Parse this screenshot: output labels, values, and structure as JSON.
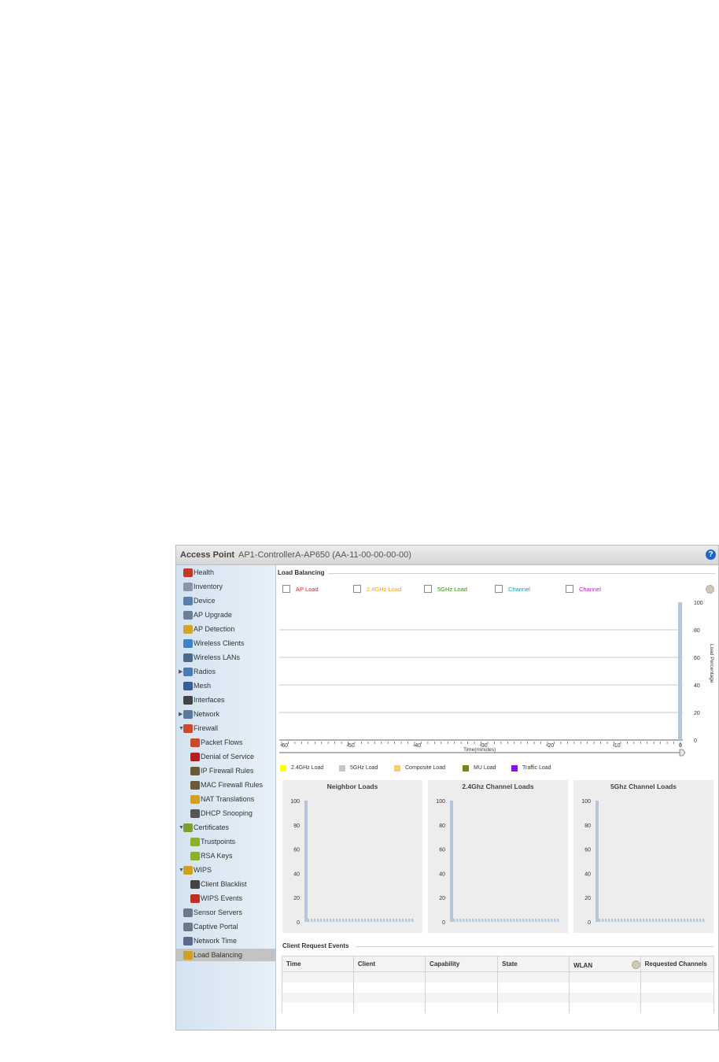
{
  "titlebar": {
    "section": "Access Point",
    "device": "AP1-ControllerA-AP650 (AA-11-00-00-00-00)",
    "help_glyph": "?"
  },
  "sidebar": {
    "items": [
      {
        "label": "Health",
        "icon": "health-icon",
        "level": 0
      },
      {
        "label": "Inventory",
        "icon": "inventory-icon",
        "level": 0
      },
      {
        "label": "Device",
        "icon": "device-icon",
        "level": 0
      },
      {
        "label": "AP Upgrade",
        "icon": "ap-upgrade-icon",
        "level": 0
      },
      {
        "label": "AP Detection",
        "icon": "ap-detection-icon",
        "level": 0
      },
      {
        "label": "Wireless Clients",
        "icon": "wireless-clients-icon",
        "level": 0
      },
      {
        "label": "Wireless LANs",
        "icon": "wireless-lans-icon",
        "level": 0
      },
      {
        "label": "Radios",
        "icon": "radios-icon",
        "level": 0,
        "expander": "collapsed"
      },
      {
        "label": "Mesh",
        "icon": "mesh-icon",
        "level": 0
      },
      {
        "label": "Interfaces",
        "icon": "interfaces-icon",
        "level": 0
      },
      {
        "label": "Network",
        "icon": "network-icon",
        "level": 0,
        "expander": "collapsed"
      },
      {
        "label": "Firewall",
        "icon": "firewall-icon",
        "level": 0,
        "expander": "expanded"
      },
      {
        "label": "Packet Flows",
        "icon": "packet-flows-icon",
        "level": 1
      },
      {
        "label": "Denial of Service",
        "icon": "denial-of-service-icon",
        "level": 1
      },
      {
        "label": "IP Firewall Rules",
        "icon": "ip-firewall-rules-icon",
        "level": 1
      },
      {
        "label": "MAC Firewall Rules",
        "icon": "mac-firewall-rules-icon",
        "level": 1
      },
      {
        "label": "NAT Translations",
        "icon": "nat-translations-icon",
        "level": 1
      },
      {
        "label": "DHCP Snooping",
        "icon": "dhcp-snooping-icon",
        "level": 1
      },
      {
        "label": "Certificates",
        "icon": "certificates-icon",
        "level": 0,
        "expander": "expanded"
      },
      {
        "label": "Trustpoints",
        "icon": "trustpoints-icon",
        "level": 1
      },
      {
        "label": "RSA Keys",
        "icon": "rsa-keys-icon",
        "level": 1
      },
      {
        "label": "WIPS",
        "icon": "wips-icon",
        "level": 0,
        "expander": "expanded"
      },
      {
        "label": "Client Blacklist",
        "icon": "client-blacklist-icon",
        "level": 1
      },
      {
        "label": "WIPS Events",
        "icon": "wips-events-icon",
        "level": 1
      },
      {
        "label": "Sensor Servers",
        "icon": "sensor-servers-icon",
        "level": 0
      },
      {
        "label": "Captive Portal",
        "icon": "captive-portal-icon",
        "level": 0
      },
      {
        "label": "Network Time",
        "icon": "network-time-icon",
        "level": 0
      },
      {
        "label": "Load Balancing",
        "icon": "load-balancing-icon",
        "level": 0,
        "selected": true
      }
    ]
  },
  "load_balancing": {
    "title": "Load Balancing",
    "toggles": [
      {
        "label": "AP Load",
        "color": "#e02020"
      },
      {
        "label": "2.4GHz Load",
        "color": "#f0a020"
      },
      {
        "label": "5GHz Load",
        "color": "#3a8a1a"
      },
      {
        "label": "Channel",
        "color": "#1a9ab0"
      },
      {
        "label": "Channel",
        "color": "#c020c0"
      }
    ],
    "settings_icon": "gear-icon",
    "chart_data": {
      "type": "bar",
      "ylabel": "Load Percentage",
      "xlabel": "Time(minutes)",
      "ylim": [
        0,
        100
      ],
      "yticks": [
        "100",
        "80",
        "60",
        "40",
        "20",
        "0"
      ],
      "xticks": [
        "-60",
        "-50",
        "-40",
        "-30",
        "-20",
        "-10",
        "0"
      ],
      "bars": [
        {
          "x": 0,
          "value": 100
        }
      ]
    },
    "legend": [
      {
        "label": "2.4GHz Load",
        "color": "#ffff00"
      },
      {
        "label": "5GHz Load",
        "color": "#c8c8c8"
      },
      {
        "label": "Composite Load",
        "color": "#f3cf70"
      },
      {
        "label": "MU Load",
        "color": "#808010"
      },
      {
        "label": "Traffic Load",
        "color": "#8a10f0"
      }
    ]
  },
  "panels": [
    {
      "title": "Neighbor Loads",
      "yticks": [
        "100",
        "80",
        "60",
        "40",
        "20",
        "0"
      ],
      "chart_data": {
        "type": "bar",
        "ylim": [
          0,
          100
        ],
        "values": [
          100,
          1,
          1,
          1,
          1,
          1,
          1,
          1,
          1,
          1,
          1,
          1,
          1,
          1,
          1,
          1,
          1,
          1,
          1,
          1,
          1,
          1,
          1,
          1,
          1,
          1,
          1,
          1,
          1,
          1,
          1,
          1,
          1,
          1,
          1
        ]
      }
    },
    {
      "title": "2.4Ghz Channel Loads",
      "yticks": [
        "100",
        "80",
        "60",
        "40",
        "20",
        "0"
      ],
      "chart_data": {
        "type": "bar",
        "ylim": [
          0,
          100
        ],
        "values": [
          100,
          1,
          1,
          1,
          1,
          1,
          1,
          1,
          1,
          1,
          1,
          1,
          1,
          1,
          1,
          1,
          1,
          1,
          1,
          1,
          1,
          1,
          1,
          1,
          1,
          1,
          1,
          1,
          1,
          1,
          1,
          1,
          1,
          1,
          1
        ]
      }
    },
    {
      "title": "5Ghz Channel Loads",
      "yticks": [
        "100",
        "80",
        "60",
        "40",
        "20",
        "0"
      ],
      "chart_data": {
        "type": "bar",
        "ylim": [
          0,
          100
        ],
        "values": [
          100,
          1,
          1,
          1,
          1,
          1,
          1,
          1,
          1,
          1,
          1,
          1,
          1,
          1,
          1,
          1,
          1,
          1,
          1,
          1,
          1,
          1,
          1,
          1,
          1,
          1,
          1,
          1,
          1,
          1,
          1,
          1,
          1,
          1,
          1
        ]
      }
    }
  ],
  "events": {
    "title": "Client Request Events",
    "columns": [
      "Time",
      "Client",
      "Capability",
      "State",
      "WLAN",
      "Requested Channels"
    ],
    "settings_icon": "gear-icon",
    "row_count": 4
  }
}
